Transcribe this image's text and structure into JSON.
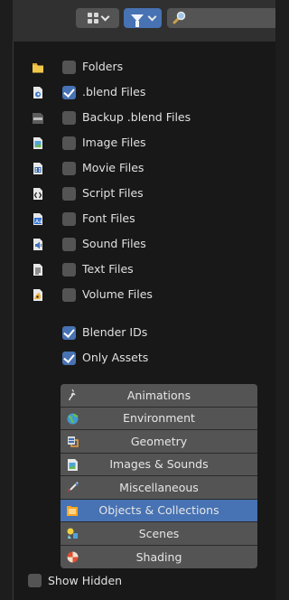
{
  "filters": {
    "file_types": [
      {
        "label": "Folders",
        "checked": false,
        "icon": "folder-icon",
        "color": "#f0c74a"
      },
      {
        "label": ".blend Files",
        "checked": true,
        "icon": "blend-file-icon",
        "color": "#6a9be0"
      },
      {
        "label": "Backup .blend Files",
        "checked": false,
        "icon": "backup-file-icon",
        "color": "#8a8a8a"
      },
      {
        "label": "Image Files",
        "checked": false,
        "icon": "image-file-icon",
        "color": "#7fbf70"
      },
      {
        "label": "Movie Files",
        "checked": false,
        "icon": "movie-file-icon",
        "color": "#5b87c8"
      },
      {
        "label": "Script Files",
        "checked": false,
        "icon": "script-file-icon",
        "color": "#dddddd"
      },
      {
        "label": "Font Files",
        "checked": false,
        "icon": "font-file-icon",
        "color": "#5a8de0"
      },
      {
        "label": "Sound Files",
        "checked": false,
        "icon": "sound-file-icon",
        "color": "#4c7bc0"
      },
      {
        "label": "Text Files",
        "checked": false,
        "icon": "text-file-icon",
        "color": "#e0e0e0"
      },
      {
        "label": "Volume Files",
        "checked": false,
        "icon": "volume-file-icon",
        "color": "#f0b040"
      }
    ],
    "blender_ids": {
      "label": "Blender IDs",
      "checked": true
    },
    "only_assets": {
      "label": "Only Assets",
      "checked": true
    },
    "asset_categories": [
      {
        "label": "Animations",
        "icon": "animation-icon",
        "color": "#dcdcdc",
        "selected": false
      },
      {
        "label": "Environment",
        "icon": "world-icon",
        "color": "#3f9bd3",
        "selected": false
      },
      {
        "label": "Geometry",
        "icon": "geometry-icon",
        "color": "#f0a040",
        "selected": false
      },
      {
        "label": "Images & Sounds",
        "icon": "image-sound-icon",
        "color": "#7fbf70",
        "selected": false
      },
      {
        "label": "Miscellaneous",
        "icon": "brush-icon",
        "color": "#d04050",
        "selected": false
      },
      {
        "label": "Objects & Collections",
        "icon": "object-collection-icon",
        "color": "#f5a623",
        "selected": true
      },
      {
        "label": "Scenes",
        "icon": "scene-icon",
        "color": "#f0d040",
        "selected": false
      },
      {
        "label": "Shading",
        "icon": "shading-icon",
        "color": "#e05030",
        "selected": false
      }
    ],
    "show_hidden": {
      "label": "Show Hidden",
      "checked": false
    }
  },
  "colors": {
    "accent": "#4772b3",
    "button": "#545454",
    "background": "#181818"
  }
}
